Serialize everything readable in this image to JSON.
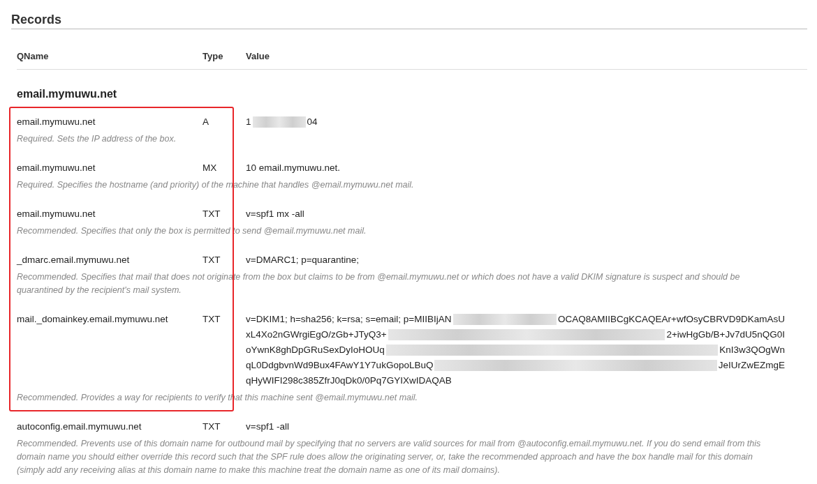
{
  "title": "Records",
  "columns": [
    "QName",
    "Type",
    "Value"
  ],
  "group": "email.mymuwu.net",
  "framed_records": [
    {
      "qname": "email.mymuwu.net",
      "type": "A",
      "value": [
        [
          {
            "kind": "text",
            "text": "1"
          },
          {
            "kind": "redacted"
          },
          {
            "kind": "text",
            "text": "04"
          }
        ]
      ],
      "description": "Required. Sets the IP address of the box."
    },
    {
      "qname": "email.mymuwu.net",
      "type": "MX",
      "value": [
        [
          {
            "kind": "text",
            "text": "10 email.mymuwu.net."
          }
        ]
      ],
      "description": "Required. Specifies the hostname (and priority) of the machine that handles @email.mymuwu.net mail."
    },
    {
      "qname": "email.mymuwu.net",
      "type": "TXT",
      "value": [
        [
          {
            "kind": "text",
            "text": "v=spf1 mx -all"
          }
        ]
      ],
      "description": "Recommended. Specifies that only the box is permitted to send @email.mymuwu.net mail."
    },
    {
      "qname": "_dmarc.email.mymuwu.net",
      "type": "TXT",
      "value": [
        [
          {
            "kind": "text",
            "text": "v=DMARC1; p=quarantine;"
          }
        ]
      ],
      "description": "Recommended. Specifies that mail that does not originate from the box but claims to be from @email.mymuwu.net or which does not have a valid DKIM signature is suspect and should be quarantined by the recipient's mail system."
    },
    {
      "qname": "mail._domainkey.email.mymuwu.net",
      "type": "TXT",
      "value": [
        [
          {
            "kind": "text",
            "text": "v=DKIM1; h=sha256; k=rsa; s=email; p=MIIBIjAN"
          },
          {
            "kind": "redacted"
          },
          {
            "kind": "text",
            "text": "OCAQ8AMIIBCgKCAQEAr+wfOsyCBRVD9DKamAsU"
          }
        ],
        [
          {
            "kind": "text",
            "text": "xL4Xo2nGWrgiEgO/zGb+JTyQ3+"
          },
          {
            "kind": "redacted"
          },
          {
            "kind": "text",
            "text": "2+iwHgGb/B+Jv7dU5nQG0I"
          }
        ],
        [
          {
            "kind": "text",
            "text": "oYwnK8ghDpGRuSexDyIoHOUq"
          },
          {
            "kind": "redacted"
          },
          {
            "kind": "text",
            "text": "KnI3w3QOgWn"
          }
        ],
        [
          {
            "kind": "text",
            "text": "qL0DdgbvnWd9Bux4FAwY1Y7ukGopoLBuQ"
          },
          {
            "kind": "redacted"
          },
          {
            "kind": "text",
            "text": "JeIUrZwEZmgE"
          }
        ],
        [
          {
            "kind": "text",
            "text": "qHyWIFI298c385ZfrJ0qDk0/0Pq7GYIXwIDAQAB"
          }
        ]
      ],
      "description": "Recommended. Provides a way for recipients to verify that this machine sent @email.mymuwu.net mail."
    }
  ],
  "records": [
    {
      "qname": "autoconfig.email.mymuwu.net",
      "type": "TXT",
      "value": [
        [
          {
            "kind": "text",
            "text": "v=spf1 -all"
          }
        ]
      ],
      "description": "Recommended. Prevents use of this domain name for outbound mail by specifying that no servers are valid sources for mail from @autoconfig.email.mymuwu.net. If you do send email from this domain name you should either override this record such that the SPF rule does allow the originating server, or, take the recommended approach and have the box handle mail for this domain (simply add any receiving alias at this domain name to make this machine treat the domain name as one of its mail domains)."
    }
  ]
}
